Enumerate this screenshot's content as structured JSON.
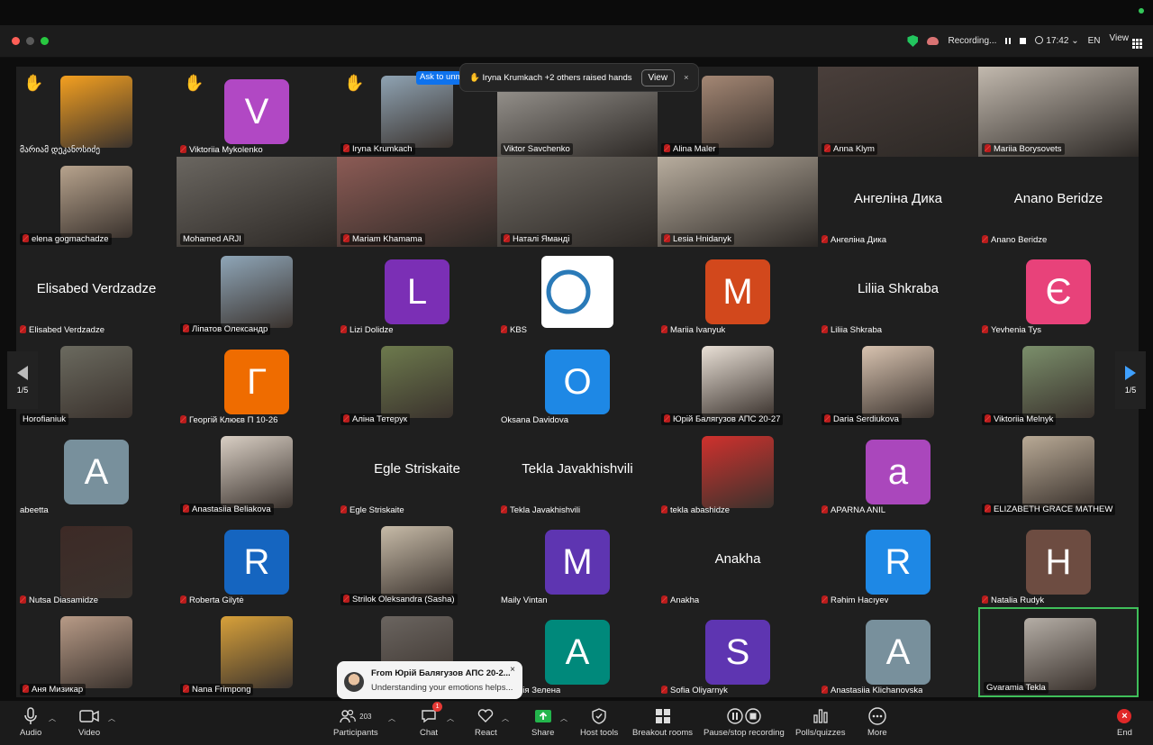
{
  "titlebar": {
    "recording_label": "Recording...",
    "time": "17:42",
    "language": "EN",
    "view_label": "View"
  },
  "raised_hands_popup": {
    "text": "✋ Iryna Krumkach +2 others raised hands",
    "view_label": "View",
    "close": "×"
  },
  "ask_unmute": "Ask to unmute",
  "pager": {
    "left": "1/5",
    "right": "1/5"
  },
  "tiles": [
    {
      "name": "მარიამ დეკანოსიძე",
      "kind": "avatar",
      "color": "#f4a020",
      "hand": "✋",
      "muted": false
    },
    {
      "name": "Viktoriia Mykolenko",
      "kind": "letter",
      "letter": "V",
      "color": "#b148c4",
      "hand": "✋",
      "muted": true
    },
    {
      "name": "Iryna Krumkach",
      "kind": "photo",
      "color": "#8fa3b3",
      "hand": "✋",
      "muted": true
    },
    {
      "name": "Viktor Savchenko",
      "kind": "full",
      "color": "#a7a39d",
      "muted": false
    },
    {
      "name": "Alina Maler",
      "kind": "photo",
      "color": "#a48774",
      "muted": true
    },
    {
      "name": "Anna Klym",
      "kind": "full",
      "color": "#4a3f3b",
      "muted": true
    },
    {
      "name": "Mariia Borysovets",
      "kind": "full",
      "color": "#c2b9ae",
      "muted": true
    },
    {
      "name": "elena gogmachadze",
      "kind": "photo",
      "color": "#b7a38d",
      "muted": true
    },
    {
      "name": "Mohamed ARJI",
      "kind": "full",
      "color": "#6a6660",
      "muted": false
    },
    {
      "name": "Mariam Khamama",
      "kind": "full",
      "color": "#8c5b55",
      "muted": true
    },
    {
      "name": "Наталі Яманді",
      "kind": "full",
      "color": "#6f6a63",
      "muted": true
    },
    {
      "name": "Lesia Hnidanyk",
      "kind": "full",
      "color": "#b8ad9e",
      "muted": true
    },
    {
      "name": "Ангеліна Дика",
      "kind": "text",
      "big": "Ангеліна Дика",
      "muted": true
    },
    {
      "name": "Anano Beridze",
      "kind": "text",
      "big": "Anano Beridze",
      "muted": true
    },
    {
      "name": "Elisabed Verdzadze",
      "kind": "text",
      "big": "Elisabed Verdzadze",
      "muted": true
    },
    {
      "name": "Ліпатов Олександр",
      "kind": "photo",
      "color": "#8fa6b8",
      "muted": true
    },
    {
      "name": "Lizi Dolidze",
      "kind": "letter",
      "letter": "L",
      "color": "#7b2fb5",
      "muted": true
    },
    {
      "name": "KBS",
      "kind": "logo",
      "color": "#ffffff",
      "muted": true
    },
    {
      "name": "Mariia Ivanyuk",
      "kind": "letter",
      "letter": "M",
      "color": "#d2481c",
      "muted": true
    },
    {
      "name": "Liliia Shkraba",
      "kind": "text",
      "big": "Liliia Shkraba",
      "muted": true
    },
    {
      "name": "Yevhenia Tys",
      "kind": "letter",
      "letter": "Є",
      "color": "#e8427a",
      "muted": true
    },
    {
      "name": "Horofianiuk",
      "kind": "photo",
      "color": "#6b6a5f",
      "muted": false
    },
    {
      "name": "Георгій Клюєв П 10-26",
      "kind": "letter",
      "letter": "Г",
      "color": "#ef6c00",
      "muted": true
    },
    {
      "name": "Аліна Тетерук",
      "kind": "photo",
      "color": "#6d7a4d",
      "muted": true
    },
    {
      "name": "Oksana Davidova",
      "kind": "letter",
      "letter": "O",
      "color": "#1e88e5",
      "muted": false
    },
    {
      "name": "Юрій Балягузов АПС 20-27",
      "kind": "photo",
      "color": "#e9e0d6",
      "muted": true
    },
    {
      "name": "Daria Serdiukova",
      "kind": "photo",
      "color": "#d8c3b0",
      "muted": true
    },
    {
      "name": "Viktoriia Melnyk",
      "kind": "photo",
      "color": "#7b8f6b",
      "muted": true
    },
    {
      "name": "abeetta",
      "kind": "letter",
      "letter": "A",
      "color": "#78909c",
      "muted": false
    },
    {
      "name": "Anastasiia Beliakova",
      "kind": "photo",
      "color": "#d9cfc4",
      "muted": true
    },
    {
      "name": "Egle Striskaite",
      "kind": "text",
      "big": "Egle Striskaite",
      "muted": true
    },
    {
      "name": "Tekla Javakhishvili",
      "kind": "text",
      "big": "Tekla Javakhishvili",
      "muted": true
    },
    {
      "name": "tekla abashidze",
      "kind": "avatar",
      "color": "#d0312d",
      "muted": true
    },
    {
      "name": "APARNA ANIL",
      "kind": "letter",
      "letter": "a",
      "color": "#aa47bc",
      "muted": true
    },
    {
      "name": "ELIZABETH GRACE MATHEW",
      "kind": "photo",
      "color": "#b9aa96",
      "muted": true
    },
    {
      "name": "Nutsa Diasamidze",
      "kind": "avatar",
      "color": "#3d2a26",
      "muted": true
    },
    {
      "name": "Roberta Gilytė",
      "kind": "letter",
      "letter": "R",
      "color": "#1565c0",
      "muted": true
    },
    {
      "name": "Strilok Oleksandra (Sasha)",
      "kind": "photo",
      "color": "#c7bba8",
      "muted": true
    },
    {
      "name": "Maily Vintan",
      "kind": "letter",
      "letter": "M",
      "color": "#5e35b1",
      "muted": false
    },
    {
      "name": "Anakha",
      "kind": "text",
      "big": "Anakha",
      "muted": true
    },
    {
      "name": "Rəhim Hacıyev",
      "kind": "letter",
      "letter": "R",
      "color": "#1e88e5",
      "muted": true
    },
    {
      "name": "Natalia Rudyk",
      "kind": "letter",
      "letter": "H",
      "color": "#6d4c41",
      "muted": true
    },
    {
      "name": "Аня Мизикар",
      "kind": "photo",
      "color": "#b89b87",
      "muted": true
    },
    {
      "name": "Nana Frimpong",
      "kind": "photo",
      "color": "#d8a13a",
      "muted": true
    },
    {
      "name": "",
      "kind": "photo",
      "color": "#6b6560",
      "muted": false
    },
    {
      "name": "астасія Зелена",
      "kind": "letter",
      "letter": "A",
      "color": "#00897b",
      "muted": false
    },
    {
      "name": "Sofia Oliyarnyk",
      "kind": "letter",
      "letter": "S",
      "color": "#5e35b1",
      "muted": true
    },
    {
      "name": "Anastasiia Klichanovska",
      "kind": "letter",
      "letter": "A",
      "color": "#78909c",
      "muted": true
    },
    {
      "name": "Gvaramia Tekla",
      "kind": "photo",
      "color": "#b5aea6",
      "muted": false,
      "active": true
    }
  ],
  "chat_toast": {
    "from": "From Юрій Балягузов АПС 20-2...",
    "message": "Understanding your emotions helps...",
    "close": "×"
  },
  "toolbar": {
    "audio": "Audio",
    "video": "Video",
    "participants": "Participants",
    "participants_count": "203",
    "chat": "Chat",
    "chat_badge": "1",
    "react": "React",
    "share": "Share",
    "host_tools": "Host tools",
    "breakout": "Breakout rooms",
    "recording": "Pause/stop recording",
    "polls": "Polls/quizzes",
    "more": "More",
    "end": "End"
  },
  "colors": {
    "accent": "#0e72ed",
    "share_green": "#23b54c",
    "active_border": "#3fbf5a",
    "end_red": "#e02828"
  }
}
